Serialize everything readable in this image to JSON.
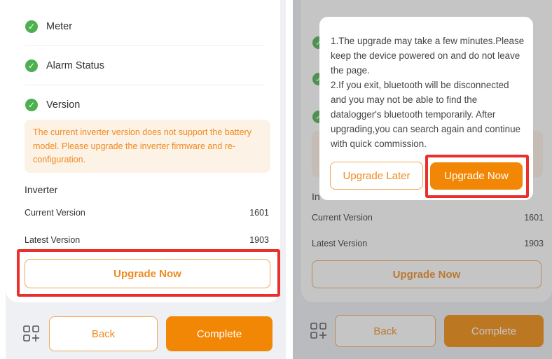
{
  "left_screen": {
    "checks": [
      {
        "label": "Meter"
      },
      {
        "label": "Alarm Status"
      },
      {
        "label": "Version"
      }
    ],
    "warning_text": "The current inverter version does not support the battery model. Please upgrade the inverter firmware and re-configuration.",
    "inverter": {
      "title": "Inverter",
      "current_version_label": "Current Version",
      "current_version_value": "1601",
      "latest_version_label": "Latest Version",
      "latest_version_value": "1903"
    },
    "upgrade_now_label": "Upgrade Now",
    "back_label": "Back",
    "complete_label": "Complete"
  },
  "right_screen": {
    "inverter": {
      "title_partial": "In",
      "current_version_label": "Current Version",
      "current_version_value": "1601",
      "latest_version_label": "Latest Version",
      "latest_version_value": "1903"
    },
    "upgrade_now_label": "Upgrade Now",
    "back_label": "Back",
    "complete_label": "Complete",
    "modal": {
      "line1": "1.The upgrade may take a few minutes.Please keep the device powered on and do not leave the page.",
      "line2": "2.If you exit, bluetooth will be disconnected and you may not be able to find the datalogger's bluetooth temporarily. After upgrading,you can search again and continue with quick commission.",
      "upgrade_later_label": "Upgrade Later",
      "upgrade_now_label": "Upgrade Now"
    }
  },
  "colors": {
    "accent": "#f28705",
    "success": "#4caf50",
    "warning_bg": "#fdf2e6",
    "highlight": "#e8302c"
  },
  "icons": {
    "check": "check-circle-icon",
    "apps": "apps-add-icon"
  }
}
